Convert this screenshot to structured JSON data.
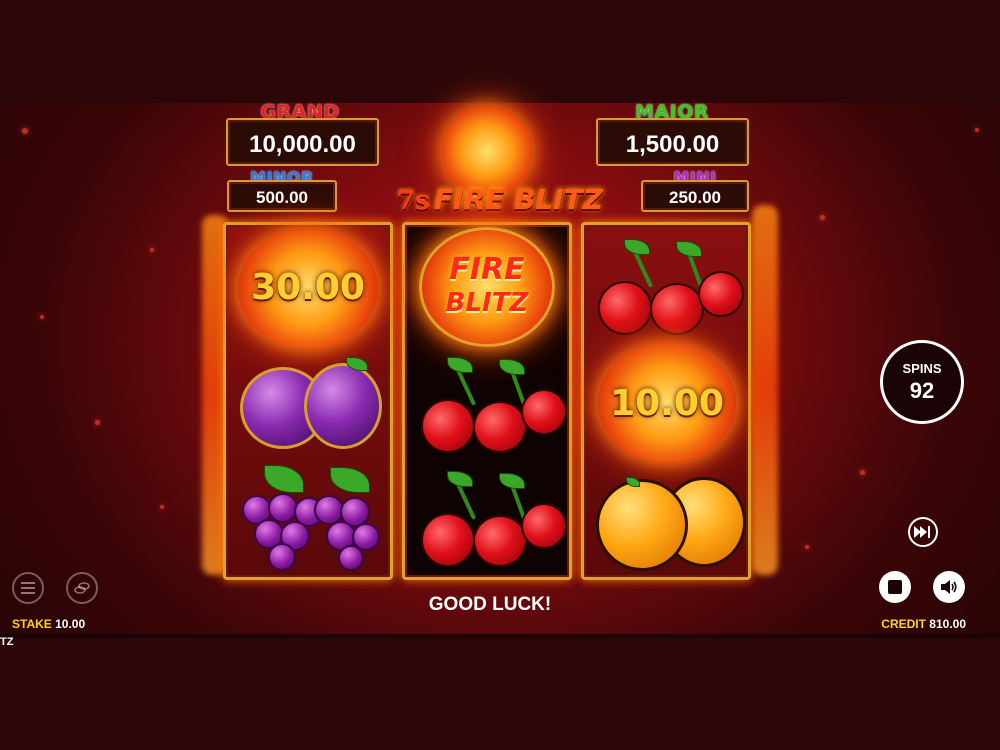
{
  "game": {
    "logo_text": "7s FIRE BLITZ",
    "logo_prefix": "7s",
    "logo_main": "FIRE BLITZ"
  },
  "jackpots": {
    "grand": {
      "label": "GRAND",
      "value": "10,000.00",
      "label_color": "#e8221a"
    },
    "major": {
      "label": "MAJOR",
      "value": "1,500.00",
      "label_color": "#3ac61a"
    },
    "minor": {
      "label": "MINOR",
      "value": "500.00",
      "label_color": "#2a7ae8"
    },
    "mini": {
      "label": "MINI",
      "value": "250.00",
      "label_color": "#b02ad8"
    }
  },
  "reels": {
    "reel1": {
      "coin_value": "30.00",
      "symbols": [
        "coin",
        "plum",
        "grapes"
      ]
    },
    "reel2": {
      "feature_text_line1": "FIRE",
      "feature_text_line2": "BLITZ",
      "symbols": [
        "fire-blitz",
        "cherries",
        "cherries"
      ]
    },
    "reel3": {
      "coin_value": "10.00",
      "symbols": [
        "cherries",
        "coin",
        "orange"
      ]
    }
  },
  "spins": {
    "label": "SPINS",
    "count": "92"
  },
  "message": "GOOD LUCK!",
  "footer": {
    "stake_label": "STAKE",
    "stake_value": "10.00",
    "credit_label": "CREDIT",
    "credit_value": "810.00",
    "left_fragment": "TZ"
  },
  "icons": {
    "menu": "menu-icon",
    "coins": "coins-icon",
    "fast_forward": "fast-forward-icon",
    "stop": "stop-icon",
    "sound": "speaker-icon"
  },
  "colors": {
    "accent_gold": "#ffcf30",
    "stake_label": "#ffd21a",
    "frame_gold": "#e2a12a"
  }
}
